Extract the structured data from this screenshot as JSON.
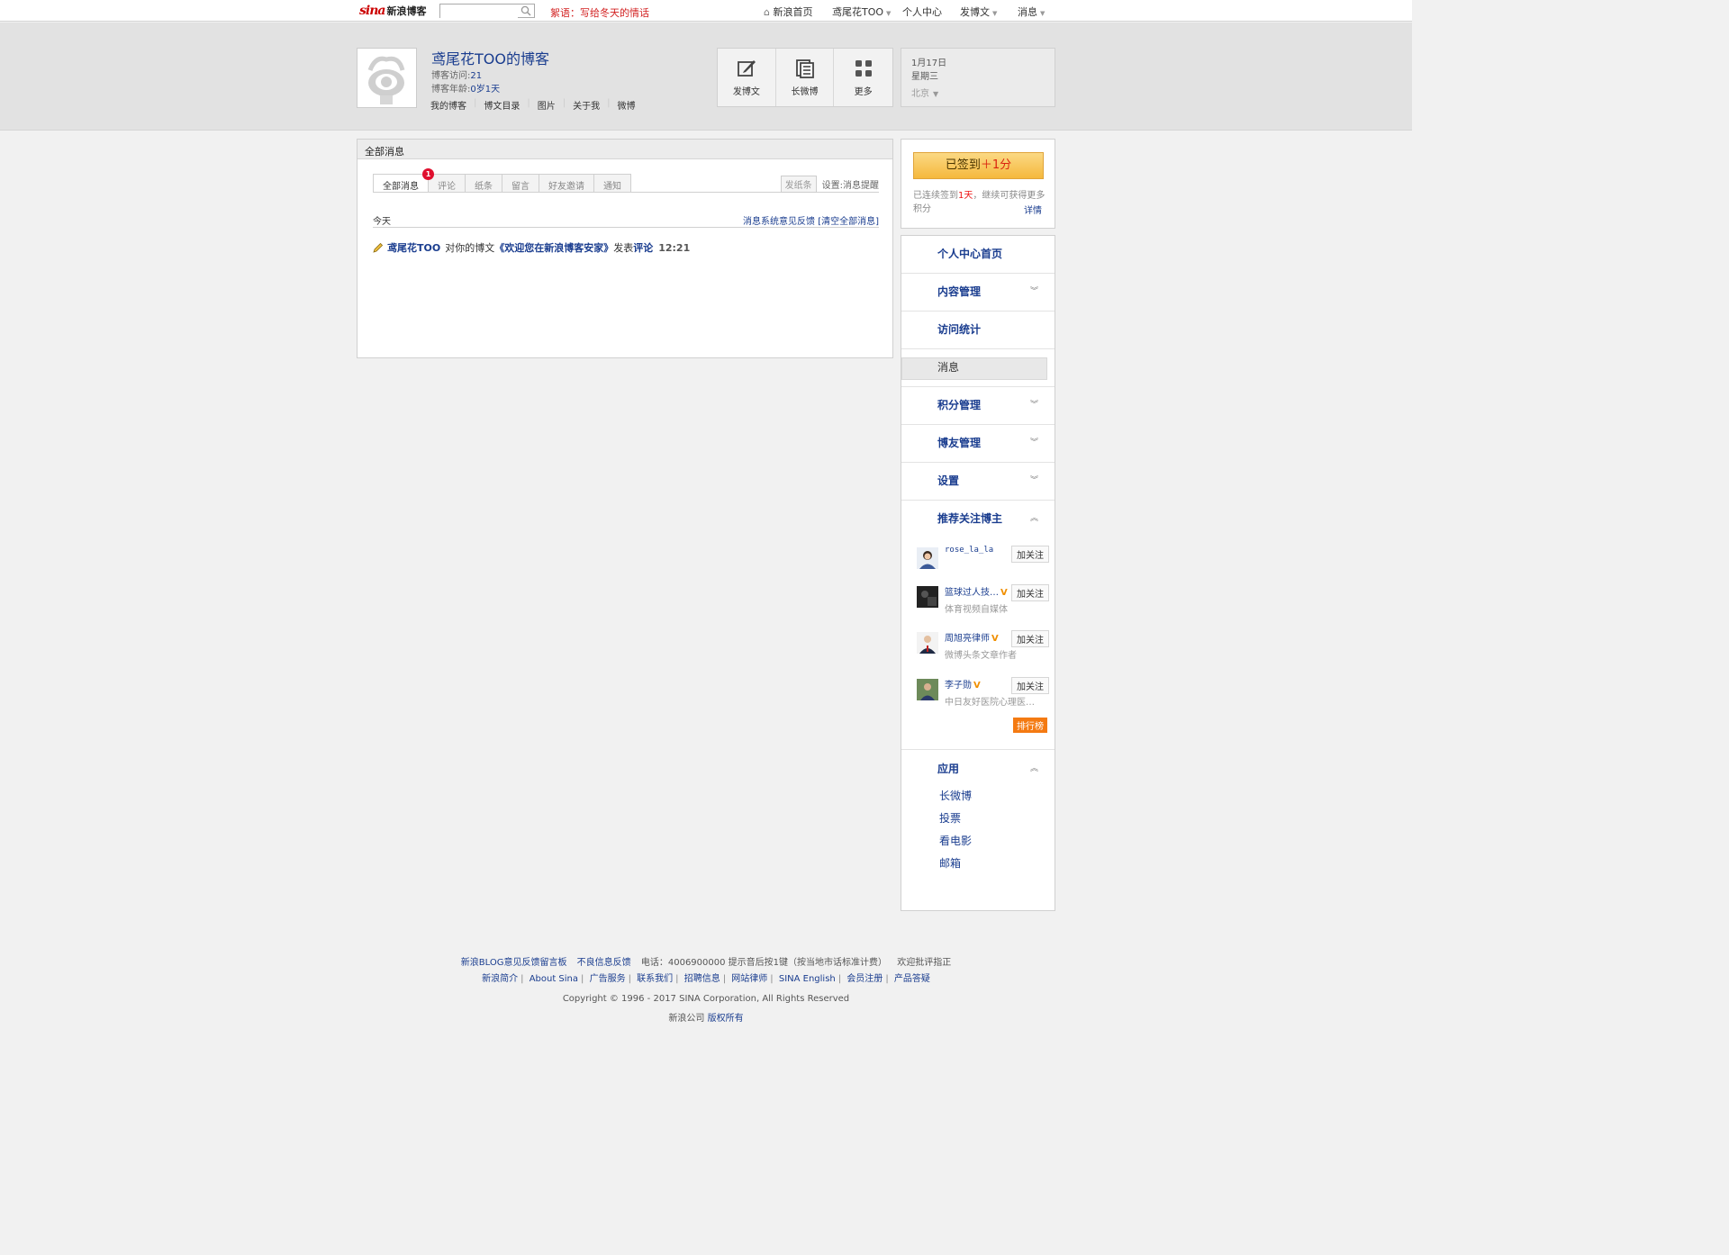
{
  "topbar": {
    "logo_sina": "sina",
    "logo_blog": "新浪博客",
    "search_placeholder": "",
    "slogan": "絮语：写给冬天的情话",
    "nav": {
      "home": "新浪首页",
      "user": "鸢尾花TOO",
      "center": "个人中心",
      "post": "发博文",
      "messages": "消息"
    }
  },
  "header": {
    "blog_title": "鸢尾花TOO的博客",
    "visits_label": "博客访问:",
    "visits_value": "21",
    "age_label": "博客年龄:",
    "age_value": "0岁1天",
    "subnav": [
      "我的博客",
      "博文目录",
      "图片",
      "关于我",
      "微博"
    ],
    "tools": [
      {
        "label": "发博文",
        "icon": "edit-icon"
      },
      {
        "label": "长微博",
        "icon": "document-icon"
      },
      {
        "label": "更多",
        "icon": "grid-icon"
      }
    ],
    "date": "1月17日",
    "weekday": "星期三",
    "city": "北京"
  },
  "messages": {
    "panel_title": "全部消息",
    "tabs": [
      "全部消息",
      "评论",
      "纸条",
      "留言",
      "好友邀请",
      "通知"
    ],
    "badge": "1",
    "send_note": "发纸条",
    "settings": "设置:消息提醒",
    "day_label": "今天",
    "feedback": "消息系统意见反馈",
    "clear_all": "[清空全部消息]",
    "item": {
      "user": "鸢尾花TOO",
      "text1": "对你的博文",
      "article": "《欢迎您在新浪博客安家》",
      "text2": "发表",
      "action": "评论",
      "time": "12:21"
    }
  },
  "signin": {
    "button_prefix": "已签到",
    "button_points": "＋1分",
    "text_prefix": "已连续签到",
    "days": "1天",
    "text_suffix": "，继续可获得更多积分",
    "details": "详情"
  },
  "menu": {
    "items": [
      "个人中心首页",
      "内容管理",
      "访问统计",
      "消息",
      "积分管理",
      "博友管理",
      "设置",
      "推荐关注博主"
    ],
    "recommend": [
      {
        "name": "rose_la_la",
        "desc": "",
        "vip": false,
        "follow": "加关注"
      },
      {
        "name": "篮球过人技…",
        "desc": "体育视频自媒体",
        "vip": true,
        "follow": "加关注"
      },
      {
        "name": "周旭亮律师",
        "desc": "微博头条文章作者",
        "vip": true,
        "follow": "加关注"
      },
      {
        "name": "李子勋",
        "desc": "中日友好医院心理医…",
        "vip": true,
        "follow": "加关注"
      }
    ],
    "rank": "排行榜",
    "apps_title": "应用",
    "apps": [
      "长微博",
      "投票",
      "看电影",
      "邮箱"
    ]
  },
  "footer": {
    "line1": [
      "新浪BLOG意见反馈留言板",
      "不良信息反馈",
      "电话：4006900000 提示音后按1键（按当地市话标准计费）",
      "欢迎批评指正"
    ],
    "line2": [
      "新浪简介",
      "About Sina",
      "广告服务",
      "联系我们",
      "招聘信息",
      "网站律师",
      "SINA English",
      "会员注册",
      "产品答疑"
    ],
    "copyright": "Copyright © 1996 - 2017 SINA Corporation, All Rights Reserved",
    "company": "新浪公司",
    "rights": "版权所有"
  },
  "colors": {
    "link": "#1a3d8f",
    "slogan": "#d21f1f",
    "badge": "#e0102f",
    "sign_button": "#f5b83c",
    "rank": "#f47a12"
  }
}
